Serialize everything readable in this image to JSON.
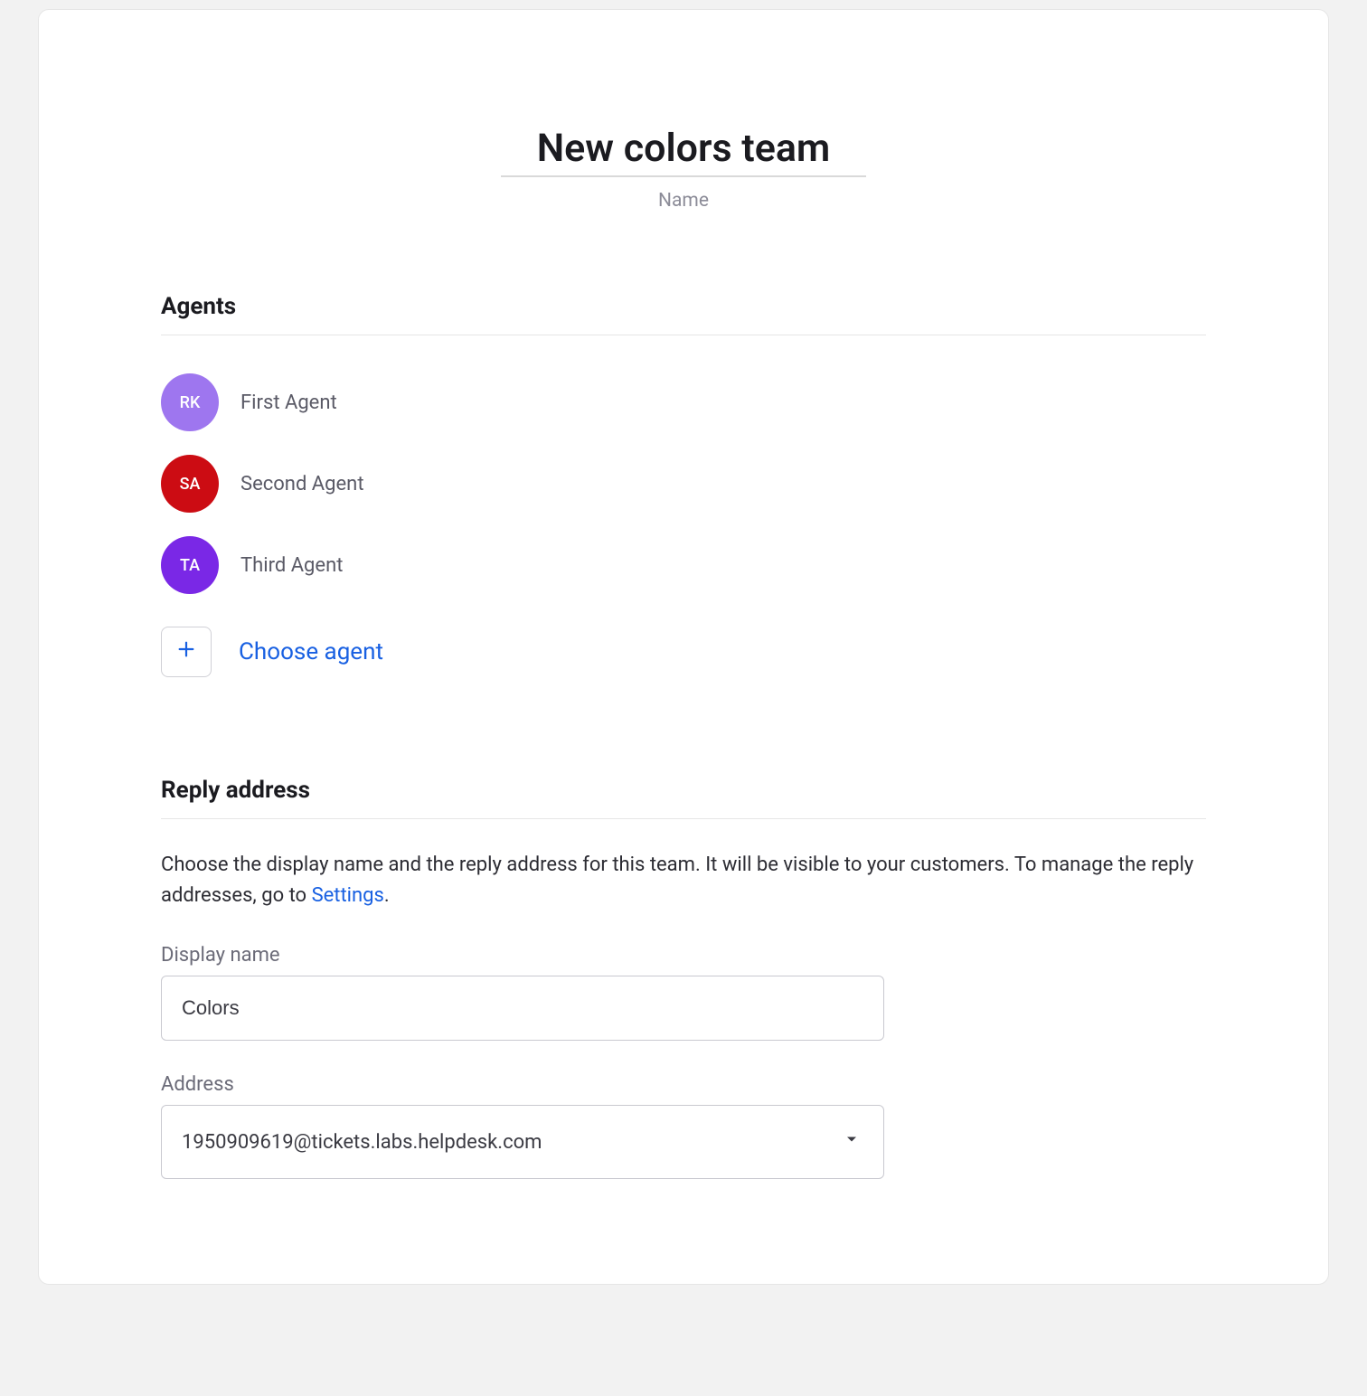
{
  "team": {
    "name": "New colors team",
    "name_label": "Name"
  },
  "sections": {
    "agents_heading": "Agents",
    "reply_heading": "Reply address"
  },
  "agents": [
    {
      "initials": "RK",
      "name": "First Agent",
      "color": "#9e76ef"
    },
    {
      "initials": "SA",
      "name": "Second Agent",
      "color": "#cc0c13"
    },
    {
      "initials": "TA",
      "name": "Third Agent",
      "color": "#7a28e6"
    }
  ],
  "choose_agent": {
    "label": "Choose agent",
    "icon": "plus-icon"
  },
  "reply": {
    "description_1": "Choose the display name and the reply address for this team. It will be visible to your customers. To manage the reply addresses, go to ",
    "settings_link": "Settings",
    "description_2": ".",
    "display_name_label": "Display name",
    "display_name_value": "Colors",
    "address_label": "Address",
    "address_value": "1950909619@tickets.labs.helpdesk.com"
  }
}
